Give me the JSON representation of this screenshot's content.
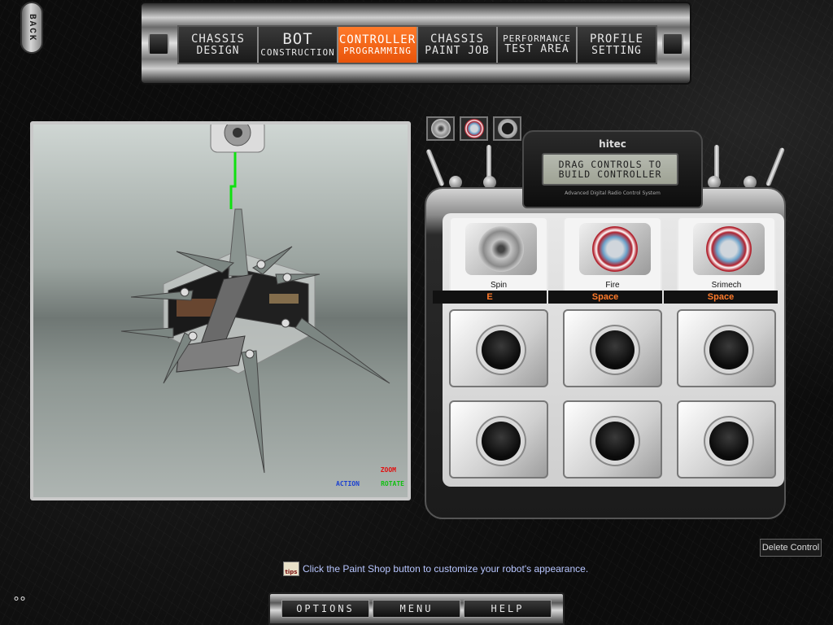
{
  "back": {
    "label": "BACK"
  },
  "nav": {
    "tabs": [
      {
        "l1": "CHASSIS",
        "l2": "DESIGN",
        "active": false
      },
      {
        "l1": "BOT",
        "l2": "CONSTRUCTION",
        "active": false
      },
      {
        "l1": "CONTROLLER",
        "l2": "PROGRAMMING",
        "active": true
      },
      {
        "l1": "CHASSIS",
        "l2": "PAINT JOB",
        "active": false
      },
      {
        "l1": "PERFORMANCE",
        "l2": "TEST AREA",
        "active": false
      },
      {
        "l1": "PROFILE",
        "l2": "SETTING",
        "active": false
      }
    ]
  },
  "viewport": {
    "legend": {
      "zoom": "ZOOM",
      "action": "ACTION",
      "rotate": "ROTATE"
    }
  },
  "remote": {
    "brand": "hitec",
    "lcd_line1": "DRAG CONTROLS TO",
    "lcd_line2": "BUILD CONTROLLER",
    "subtitle": "Advanced Digital Radio Control System",
    "controls": [
      {
        "name": "Spin",
        "key": "E",
        "icon": "spin-disc-icon"
      },
      {
        "name": "Fire",
        "key": "Space",
        "icon": "fire-disc-icon"
      },
      {
        "name": "Srimech",
        "key": "Space",
        "icon": "srimech-disc-icon"
      }
    ],
    "empty_slots": 6
  },
  "delete_control": "Delete Control",
  "tip": {
    "icon_label": "tips",
    "text": "Click the Paint Shop button to customize your robot's appearance."
  },
  "bottom": {
    "options": "OPTIONS",
    "menu": "MENU",
    "help": "HELP"
  },
  "colors": {
    "accent": "#f06010",
    "tip_text": "#b8c6ff",
    "key_text": "#ff7a2a"
  }
}
